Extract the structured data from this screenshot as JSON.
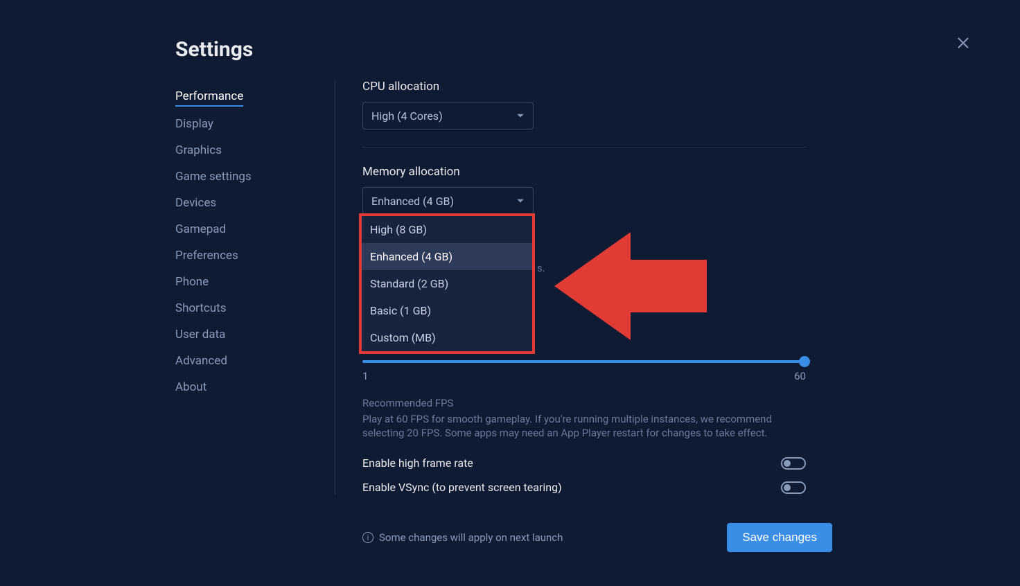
{
  "title": "Settings",
  "sidebar": {
    "items": [
      {
        "label": "Performance",
        "active": true
      },
      {
        "label": "Display"
      },
      {
        "label": "Graphics"
      },
      {
        "label": "Game settings"
      },
      {
        "label": "Devices"
      },
      {
        "label": "Gamepad"
      },
      {
        "label": "Preferences"
      },
      {
        "label": "Phone"
      },
      {
        "label": "Shortcuts"
      },
      {
        "label": "User data"
      },
      {
        "label": "Advanced"
      },
      {
        "label": "About"
      }
    ]
  },
  "cpu": {
    "label": "CPU allocation",
    "value": "High (4 Cores)"
  },
  "memory": {
    "label": "Memory allocation",
    "value": "Enhanced (4 GB)",
    "options": [
      "High (8 GB)",
      "Enhanced (4 GB)",
      "Standard (2 GB)",
      "Basic (1 GB)",
      "Custom (MB)"
    ]
  },
  "hidden_text_fragment": "s.",
  "slider": {
    "min": "1",
    "max": "60"
  },
  "fps": {
    "title": "Recommended FPS",
    "text": "Play at 60 FPS for smooth gameplay. If you're running multiple instances, we recommend selecting 20 FPS. Some apps may need an App Player restart for changes to take effect."
  },
  "high_frame_rate_label": "Enable high frame rate",
  "vsync_label": "Enable VSync (to prevent screen tearing)",
  "footer_note": "Some changes will apply on next launch",
  "save_label": "Save changes"
}
